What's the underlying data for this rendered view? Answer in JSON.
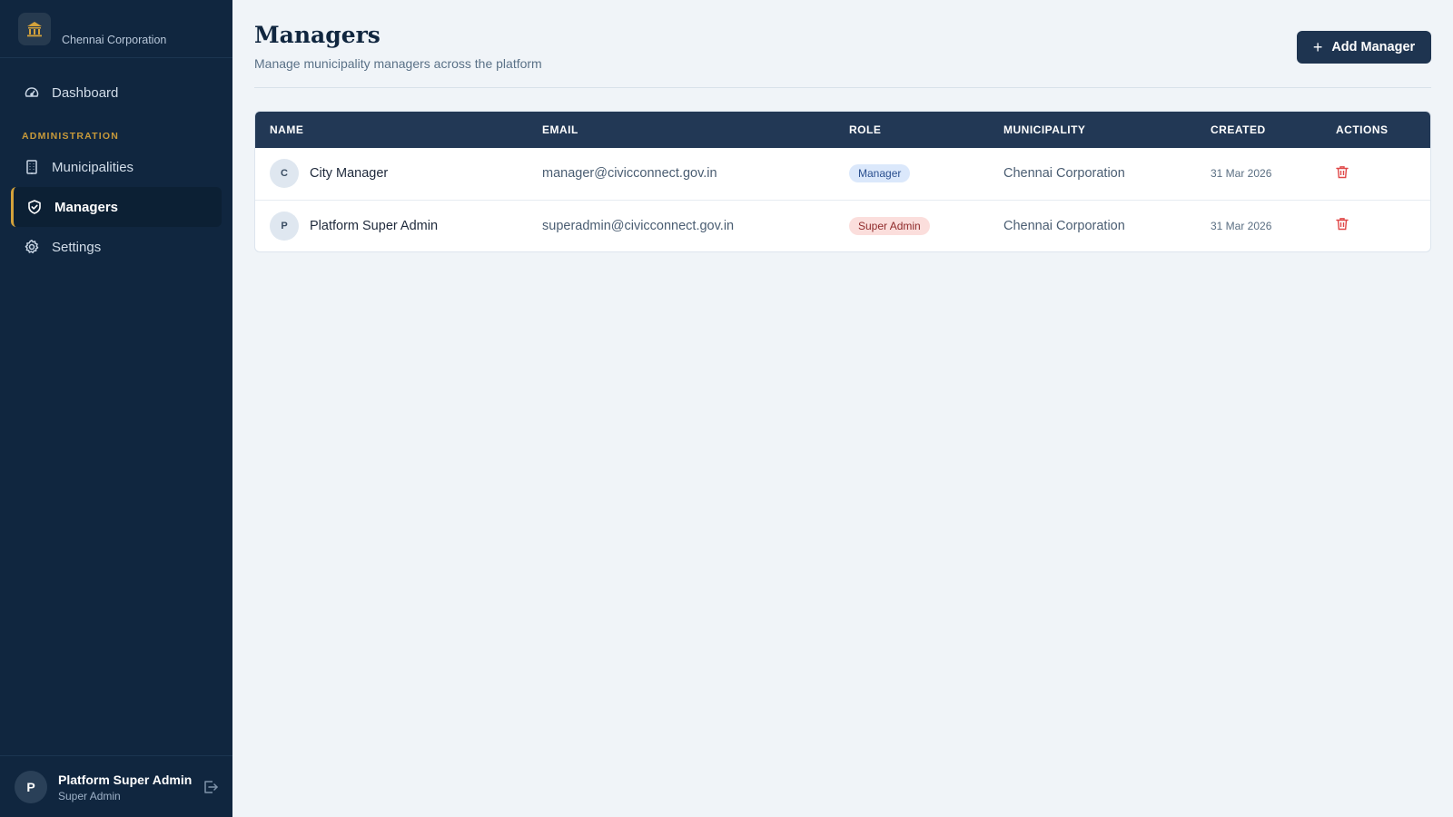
{
  "brand": {
    "name": "Chennai Corporation",
    "logo_icon": "bank-icon"
  },
  "nav": {
    "items": [
      {
        "label": "Dashboard",
        "icon": "speedometer-icon"
      },
      {
        "label": "Municipalities",
        "icon": "building-icon"
      },
      {
        "label": "Managers",
        "icon": "shield-icon",
        "active": true
      },
      {
        "label": "Settings",
        "icon": "gear-icon"
      }
    ],
    "section_admin": "ADMINISTRATION"
  },
  "user": {
    "initial": "P",
    "name": "Platform Super Admin",
    "role": "Super Admin"
  },
  "page": {
    "title": "Managers",
    "subtitle": "Manage municipality managers across the platform",
    "add_button": "Add Manager"
  },
  "table": {
    "headers": [
      "NAME",
      "EMAIL",
      "ROLE",
      "MUNICIPALITY",
      "CREATED",
      "ACTIONS"
    ],
    "rows": [
      {
        "initial": "C",
        "name": "City Manager",
        "email": "manager@civicconnect.gov.in",
        "role": "Manager",
        "municipality": "Chennai Corporation",
        "created": "31 Mar 2026"
      },
      {
        "initial": "P",
        "name": "Platform Super Admin",
        "email": "superadmin@civicconnect.gov.in",
        "role": "Super Admin",
        "municipality": "Chennai Corporation",
        "created": "31 Mar 2026"
      }
    ]
  },
  "colors": {
    "sidebar": "#10263f",
    "accent": "#d4a23b",
    "danger": "#e04848"
  }
}
